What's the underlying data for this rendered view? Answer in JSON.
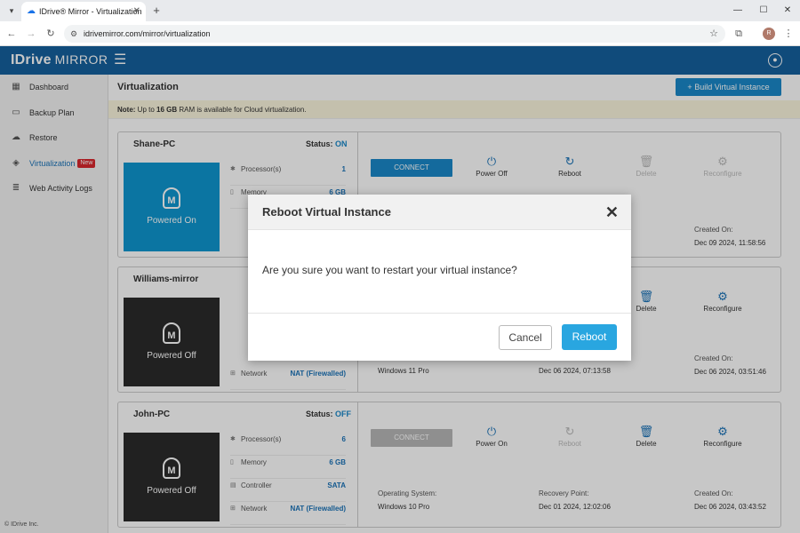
{
  "browser": {
    "tab_title": "IDrive® Mirror - Virtualization",
    "url": "idrivemirror.com/mirror/virtualization",
    "profile_initial": "R"
  },
  "app": {
    "logo_main": "IDrive",
    "logo_sub": "MIRROR",
    "brand_color": "#15609e"
  },
  "sidebar": {
    "items": [
      {
        "label": "Dashboard",
        "icon": "dashboard-icon"
      },
      {
        "label": "Backup Plan",
        "icon": "monitor-icon"
      },
      {
        "label": "Restore",
        "icon": "cloud-icon"
      },
      {
        "label": "Virtualization",
        "icon": "cube-icon",
        "badge": "New"
      },
      {
        "label": "Web Activity Logs",
        "icon": "list-icon"
      }
    ],
    "footer": "© IDrive Inc."
  },
  "main": {
    "title": "Virtualization",
    "build_button": "Build Virtual Instance",
    "note_prefix": "Note:",
    "note_text_1": " Up to ",
    "note_ram": "16 GB",
    "note_text_2": " RAM is available for Cloud virtualization."
  },
  "labels": {
    "status": "Status:",
    "connect": "CONNECT",
    "reboot": "Reboot",
    "delete": "Delete",
    "reconfigure": "Reconfigure",
    "os": "Operating System:",
    "recovery": "Recovery Point:",
    "created": "Created On:",
    "processors": "Processor(s)",
    "memory": "Memory",
    "controller": "Controller",
    "network": "Network"
  },
  "vms": [
    {
      "name": "Shane-PC",
      "status": "ON",
      "state_label": "Powered On",
      "power_action": "Power Off",
      "processors": "1",
      "memory": "6 GB",
      "created": "Dec 09 2024, 11:58:56"
    },
    {
      "name": "Williams-mirror",
      "state_label": "Powered Off",
      "network": "NAT (Firewalled)",
      "os": "Windows 11 Pro",
      "recovery": "Dec 06 2024, 07:13:58",
      "created": "Dec 06 2024, 03:51:46"
    },
    {
      "name": "John-PC",
      "status": "OFF",
      "state_label": "Powered Off",
      "power_action": "Power On",
      "processors": "6",
      "memory": "6 GB",
      "controller": "SATA",
      "network": "NAT (Firewalled)",
      "os": "Windows 10 Pro",
      "recovery": "Dec 01 2024, 12:02:06",
      "created": "Dec 06 2024, 03:43:52"
    }
  ],
  "modal": {
    "title": "Reboot Virtual Instance",
    "message": "Are you sure you want to restart your virtual instance?",
    "cancel": "Cancel",
    "confirm": "Reboot"
  }
}
